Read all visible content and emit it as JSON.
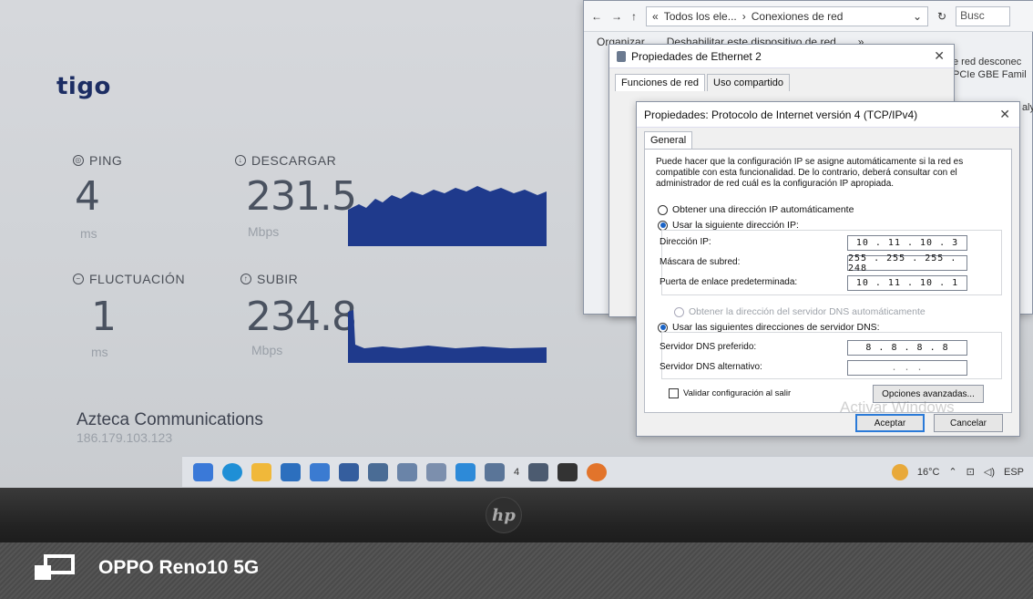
{
  "speedtest": {
    "logo": "tigo",
    "ping": {
      "label": "PING",
      "value": "4",
      "unit": "ms"
    },
    "download": {
      "label": "DESCARGAR",
      "value": "231.5",
      "unit": "Mbps"
    },
    "jitter": {
      "label": "FLUCTUACIÓN",
      "value": "1",
      "unit": "ms"
    },
    "upload": {
      "label": "SUBIR",
      "value": "234.8",
      "unit": "Mbps"
    },
    "provider": "Azteca Communications",
    "ip": "186.179.103.123"
  },
  "explorer": {
    "breadcrumb_prefix": "«",
    "breadcrumb_1": "Todos los ele...",
    "breadcrumb_2": "Conexiones de red",
    "search_placeholder": "Busc",
    "toolbar_organize": "Organizar",
    "toolbar_disable": "Deshabilitar este dispositivo de red",
    "toolbar_more": "»",
    "right_text_1": "e red desconec",
    "right_text_2": "PCIe GBE Famil",
    "right_text_3": "aly"
  },
  "ethernet_props": {
    "title": "Propiedades de Ethernet 2",
    "tab_1": "Funciones de red",
    "tab_2": "Uso compartido"
  },
  "ipv4": {
    "title": "Propiedades: Protocolo de Internet versión 4 (TCP/IPv4)",
    "tab_general": "General",
    "description": "Puede hacer que la configuración IP se asigne automáticamente si la red es compatible con esta funcionalidad. De lo contrario, deberá consultar con el administrador de red cuál es la configuración IP apropiada.",
    "radio_auto_ip": "Obtener una dirección IP automáticamente",
    "radio_static_ip": "Usar la siguiente dirección IP:",
    "label_ip": "Dirección IP:",
    "value_ip": "10 . 11 . 10 . 3",
    "label_mask": "Máscara de subred:",
    "value_mask": "255 . 255 . 255 . 248",
    "label_gateway": "Puerta de enlace predeterminada:",
    "value_gateway": "10 . 11 . 10 . 1",
    "radio_auto_dns": "Obtener la dirección del servidor DNS automáticamente",
    "radio_static_dns": "Usar las siguientes direcciones de servidor DNS:",
    "label_dns_pref": "Servidor DNS preferido:",
    "value_dns_pref": "8 . 8 . 8 . 8",
    "label_dns_alt": "Servidor DNS alternativo:",
    "value_dns_alt": ". . .",
    "validate_label": "Validar configuración al salir",
    "advanced_button": "Opciones avanzadas...",
    "accept_button": "Aceptar",
    "cancel_button": "Cancelar",
    "watermark": "Activar Windows"
  },
  "taskbar": {
    "weather": "16°C",
    "language": "ESP",
    "mail_badge": "4"
  },
  "phone": {
    "label": "OPPO Reno10 5G"
  },
  "colors": {
    "graph": "#1f3a8c",
    "logo": "#1c2d63",
    "accent": "#2a7ad8"
  }
}
